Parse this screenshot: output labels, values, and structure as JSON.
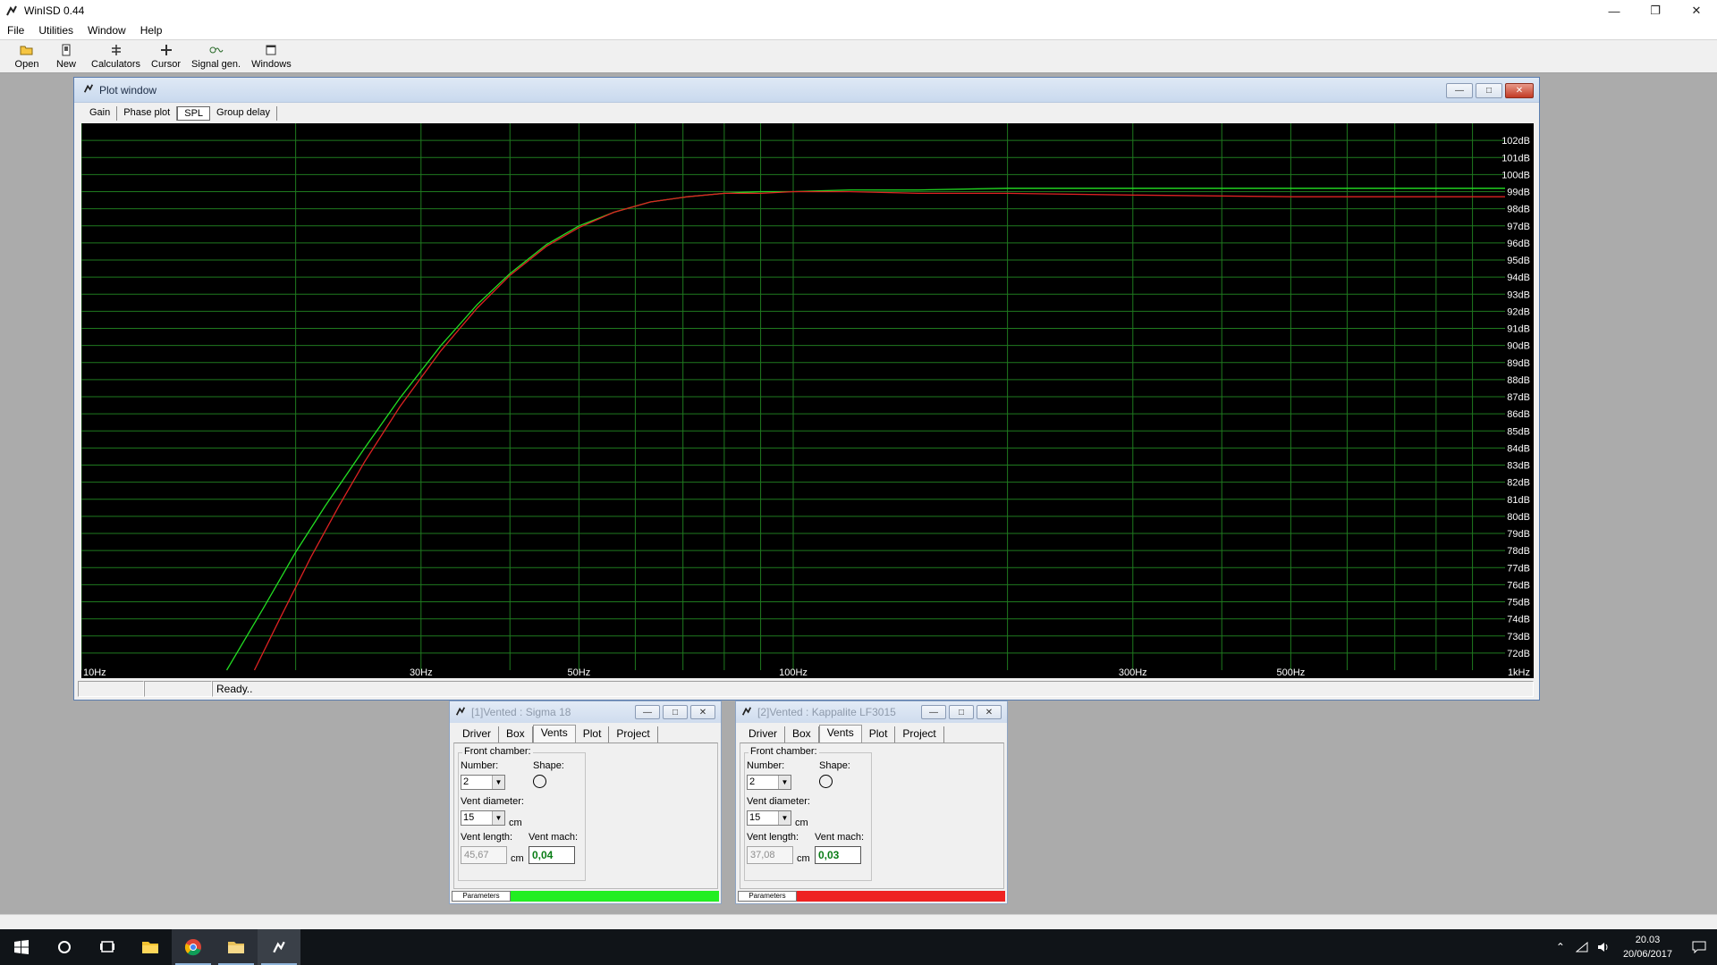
{
  "app": {
    "title": "WinISD 0.44",
    "window_controls": [
      "minimize-icon",
      "restore-icon",
      "close-icon"
    ]
  },
  "menu": [
    "File",
    "Utilities",
    "Window",
    "Help"
  ],
  "toolbar": [
    {
      "label": "Open",
      "icon": "folder-open-icon"
    },
    {
      "label": "New",
      "icon": "new-document-icon"
    },
    {
      "label": "Calculators",
      "icon": "calculator-icon"
    },
    {
      "label": "Cursor",
      "icon": "crosshair-cursor-icon"
    },
    {
      "label": "Signal gen.",
      "icon": "signal-generator-icon"
    },
    {
      "label": "Windows",
      "icon": "windows-icon"
    }
  ],
  "plot_window": {
    "title": "Plot window",
    "tabs": [
      "Gain",
      "Phase plot",
      "SPL",
      "Group delay"
    ],
    "active_tab": "SPL",
    "status": "Ready.."
  },
  "chart_data": {
    "type": "line",
    "x_scale": "log",
    "xlim": [
      10,
      1000
    ],
    "x_unit": "Hz",
    "x_tick_labels": [
      {
        "value": 10,
        "label": "10Hz"
      },
      {
        "value": 30,
        "label": "30Hz"
      },
      {
        "value": 50,
        "label": "50Hz"
      },
      {
        "value": 100,
        "label": "100Hz"
      },
      {
        "value": 300,
        "label": "300Hz"
      },
      {
        "value": 500,
        "label": "500Hz"
      },
      {
        "value": 1000,
        "label": "1kHz"
      }
    ],
    "ylim": [
      71,
      103
    ],
    "y_unit": "dB",
    "y_tick_labels": [
      "102dB",
      "101dB",
      "100dB",
      "99dB",
      "98dB",
      "97dB",
      "96dB",
      "95dB",
      "94dB",
      "93dB",
      "92dB",
      "91dB",
      "90dB",
      "89dB",
      "88dB",
      "87dB",
      "86dB",
      "85dB",
      "84dB",
      "83dB",
      "82dB",
      "81dB",
      "80dB",
      "79dB",
      "78dB",
      "77dB",
      "76dB",
      "75dB",
      "74dB",
      "73dB",
      "72dB"
    ],
    "y_tick_values": [
      102,
      101,
      100,
      99,
      98,
      97,
      96,
      95,
      94,
      93,
      92,
      91,
      90,
      89,
      88,
      87,
      86,
      85,
      84,
      83,
      82,
      81,
      80,
      79,
      78,
      77,
      76,
      75,
      74,
      73,
      72
    ],
    "grid": true,
    "background": "#000000",
    "grid_color": "#1f7a1f",
    "series": [
      {
        "color": "#22dd22",
        "x": [
          16,
          18,
          20,
          22,
          25,
          28,
          32,
          36,
          40,
          45,
          50,
          56,
          63,
          71,
          80,
          90,
          100,
          120,
          150,
          200,
          300,
          500,
          700,
          1000
        ],
        "y": [
          71,
          74.6,
          77.9,
          80.6,
          84.0,
          86.9,
          90.0,
          92.4,
          94.2,
          95.9,
          97.0,
          97.8,
          98.4,
          98.7,
          98.9,
          99.0,
          99.0,
          99.1,
          99.1,
          99.2,
          99.2,
          99.2,
          99.2,
          99.2
        ]
      },
      {
        "color": "#dd2222",
        "x": [
          17.5,
          19,
          21,
          23,
          25,
          28,
          32,
          36,
          40,
          45,
          50,
          56,
          63,
          71,
          80,
          90,
          100,
          120,
          150,
          200,
          300,
          500,
          700,
          1000
        ],
        "y": [
          71,
          74.0,
          77.6,
          80.6,
          83.2,
          86.4,
          89.7,
          92.2,
          94.1,
          95.8,
          96.9,
          97.8,
          98.4,
          98.7,
          98.9,
          98.9,
          99.0,
          99.0,
          98.9,
          98.9,
          98.8,
          98.7,
          98.7,
          98.7
        ]
      }
    ]
  },
  "box_windows": [
    {
      "title": "[1]Vented : Sigma 18",
      "tabs": [
        "Driver",
        "Box",
        "Vents",
        "Plot",
        "Project"
      ],
      "active_tab": "Vents",
      "group_title": "Front chamber:",
      "number_label": "Number:",
      "number_value": "2",
      "shape_label": "Shape:",
      "diameter_label": "Vent diameter:",
      "diameter_value": "15",
      "diameter_unit": "cm",
      "length_label": "Vent length:",
      "length_value": "45,67",
      "length_unit": "cm",
      "mach_label": "Vent mach:",
      "mach_value": "0,04",
      "footer_tab": "Parameters",
      "status_color": "#22ee22"
    },
    {
      "title": "[2]Vented : Kappalite LF3015",
      "tabs": [
        "Driver",
        "Box",
        "Vents",
        "Plot",
        "Project"
      ],
      "active_tab": "Vents",
      "group_title": "Front chamber:",
      "number_label": "Number:",
      "number_value": "2",
      "shape_label": "Shape:",
      "diameter_label": "Vent diameter:",
      "diameter_value": "15",
      "diameter_unit": "cm",
      "length_label": "Vent length:",
      "length_value": "37,08",
      "length_unit": "cm",
      "mach_label": "Vent mach:",
      "mach_value": "0,03",
      "footer_tab": "Parameters",
      "status_color": "#ee2222"
    }
  ],
  "taskbar": {
    "items": [
      "windows-start-icon",
      "search-circle-icon",
      "task-view-icon",
      "file-explorer-icon",
      "chrome-icon",
      "folder-icon",
      "winisd-icon"
    ],
    "clock_time": "20.03",
    "clock_date": "20/06/2017",
    "tray_icons": [
      "chevron-up-icon",
      "network-icon",
      "volume-icon"
    ]
  }
}
